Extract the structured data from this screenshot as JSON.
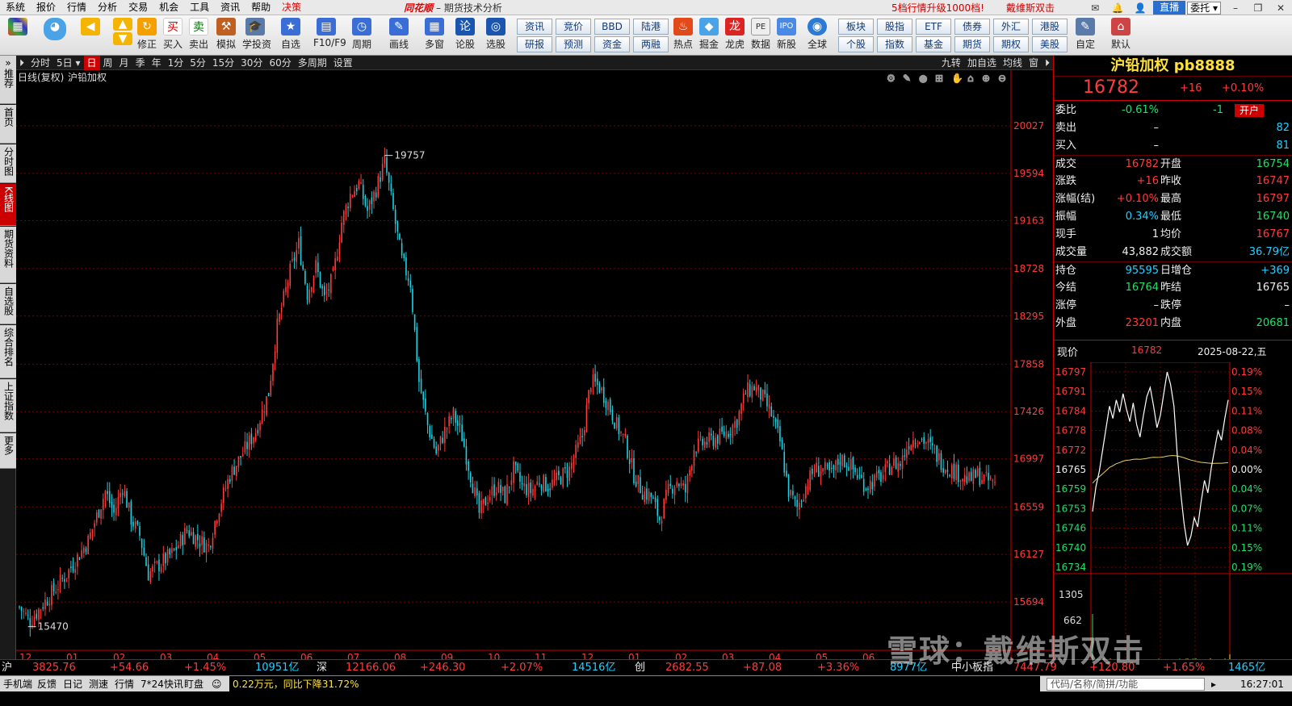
{
  "menubar": {
    "items": [
      "系统",
      "报价",
      "行情",
      "分析",
      "交易",
      "机会",
      "工具",
      "资讯",
      "帮助",
      "决策"
    ],
    "brand": "同花顺",
    "title": "期货技术分析",
    "promo": "5档行情升级1000档!",
    "promo2": "戴维斯双击",
    "live": "直播",
    "combo": "委托"
  },
  "toolbar": {
    "buttons": [
      "",
      "修正",
      "买入",
      "卖出",
      "模拟",
      "学投资",
      "自选",
      "F10/F9",
      "周期",
      "画线",
      "多窗",
      "论股",
      "选股",
      "",
      "热点",
      "掘金",
      "龙虎",
      "数据",
      "新股",
      "全球",
      "",
      "",
      "自定",
      "默认"
    ],
    "grid1": [
      "资讯",
      "竞价",
      "BBD",
      "陆港",
      "研报",
      "预测",
      "资金",
      "两融"
    ],
    "grid2": [
      "板块",
      "股指",
      "ETF",
      "债券",
      "外汇",
      "港股",
      "个股",
      "指数",
      "基金",
      "期货",
      "期权",
      "美股"
    ]
  },
  "vtabs": [
    "推荐",
    "首页",
    "分时图",
    "K线图",
    "期货资料",
    "自选股",
    "综合排名",
    "上证指数",
    "更多"
  ],
  "chart_toolbar": {
    "periods": [
      "分时",
      "5日",
      "日",
      "周",
      "月",
      "季",
      "年",
      "1分",
      "5分",
      "15分",
      "30分",
      "60分",
      "多周期",
      "设置"
    ],
    "active": "日",
    "right": [
      "九转",
      "加自选",
      "均线",
      "窗"
    ]
  },
  "chart_header": {
    "line": "日线(复权)",
    "name": "沪铅加权"
  },
  "chart_data": {
    "type": "candlestick",
    "ylim": [
      15262,
      20459
    ],
    "y_ticks": [
      20027,
      19594,
      19163,
      18728,
      18295,
      17858,
      17426,
      16997,
      16559,
      16127,
      15694
    ],
    "x_labels": [
      "12",
      "01",
      "02",
      "03",
      "04",
      "05",
      "06",
      "07",
      "08",
      "09",
      "10",
      "11",
      "12",
      "01",
      "02",
      "03",
      "04",
      "05",
      "06"
    ],
    "max_label": "19757",
    "min_label": "15470",
    "path_points": [
      [
        0,
        15650
      ],
      [
        5,
        15520
      ],
      [
        12,
        15700
      ],
      [
        22,
        15950
      ],
      [
        32,
        16250
      ],
      [
        40,
        16700
      ],
      [
        44,
        16500
      ],
      [
        48,
        16750
      ],
      [
        52,
        16450
      ],
      [
        56,
        16300
      ],
      [
        60,
        15950
      ],
      [
        66,
        16050
      ],
      [
        72,
        16150
      ],
      [
        78,
        16350
      ],
      [
        84,
        16250
      ],
      [
        88,
        16200
      ],
      [
        92,
        16500
      ],
      [
        98,
        16850
      ],
      [
        104,
        17050
      ],
      [
        110,
        17250
      ],
      [
        116,
        17600
      ],
      [
        120,
        18200
      ],
      [
        126,
        18700
      ],
      [
        130,
        18950
      ],
      [
        134,
        18500
      ],
      [
        138,
        18750
      ],
      [
        142,
        18450
      ],
      [
        146,
        18650
      ],
      [
        150,
        19150
      ],
      [
        154,
        19400
      ],
      [
        158,
        19500
      ],
      [
        162,
        19250
      ],
      [
        166,
        19450
      ],
      [
        170,
        19700
      ],
      [
        174,
        19250
      ],
      [
        178,
        18800
      ],
      [
        182,
        18600
      ],
      [
        186,
        17700
      ],
      [
        190,
        17300
      ],
      [
        194,
        17050
      ],
      [
        198,
        17250
      ],
      [
        202,
        17400
      ],
      [
        206,
        17200
      ],
      [
        210,
        16850
      ],
      [
        214,
        16500
      ],
      [
        218,
        16650
      ],
      [
        222,
        16750
      ],
      [
        226,
        16650
      ],
      [
        230,
        16900
      ],
      [
        234,
        16750
      ],
      [
        238,
        16700
      ],
      [
        242,
        16800
      ],
      [
        246,
        16750
      ],
      [
        250,
        16800
      ],
      [
        256,
        16900
      ],
      [
        262,
        17200
      ],
      [
        266,
        17700
      ],
      [
        270,
        17650
      ],
      [
        274,
        17500
      ],
      [
        278,
        17300
      ],
      [
        282,
        17150
      ],
      [
        286,
        16850
      ],
      [
        290,
        16700
      ],
      [
        294,
        16650
      ],
      [
        298,
        16450
      ],
      [
        302,
        16700
      ],
      [
        306,
        16800
      ],
      [
        310,
        16700
      ],
      [
        314,
        17100
      ],
      [
        320,
        17150
      ],
      [
        326,
        17200
      ],
      [
        330,
        17250
      ],
      [
        334,
        17350
      ],
      [
        338,
        17600
      ],
      [
        342,
        17650
      ],
      [
        346,
        17550
      ],
      [
        350,
        17400
      ],
      [
        354,
        17150
      ],
      [
        358,
        16700
      ],
      [
        362,
        16550
      ],
      [
        366,
        16750
      ],
      [
        370,
        16900
      ],
      [
        374,
        16900
      ],
      [
        378,
        16850
      ],
      [
        382,
        17000
      ],
      [
        386,
        16950
      ],
      [
        390,
        16850
      ],
      [
        394,
        16750
      ],
      [
        398,
        16800
      ],
      [
        402,
        16850
      ],
      [
        406,
        16950
      ],
      [
        410,
        16950
      ],
      [
        414,
        17150
      ],
      [
        418,
        17200
      ],
      [
        422,
        17150
      ],
      [
        426,
        17050
      ],
      [
        430,
        16950
      ],
      [
        434,
        16900
      ],
      [
        438,
        16850
      ],
      [
        442,
        16800
      ],
      [
        446,
        16850
      ],
      [
        450,
        16800
      ],
      [
        454,
        16780
      ]
    ]
  },
  "right_panel": {
    "name": "沪铅加权 pb8888",
    "price": "16782",
    "change": "+16",
    "change_pct": "+0.10%",
    "rows": [
      {
        "l1": "委比",
        "v1": "-0.61%",
        "c1": "grn",
        "v1b": "-1",
        "c1b": "grn",
        "tag": "开户"
      },
      {
        "l1": "卖出",
        "v1": "–",
        "c1": "wht",
        "v1b": "82",
        "c1b": "cyn"
      },
      {
        "l1": "买入",
        "v1": "–",
        "c1": "wht",
        "v1b": "81",
        "c1b": "cyn"
      },
      {
        "l1": "成交",
        "v1": "16782",
        "c1": "red",
        "l2": "开盘",
        "v2": "16754",
        "c2": "grn"
      },
      {
        "l1": "涨跌",
        "v1": "+16",
        "c1": "red",
        "l2": "昨收",
        "v2": "16747",
        "c2": "red"
      },
      {
        "l1": "涨幅(结)",
        "v1": "+0.10%",
        "c1": "red",
        "l2": "最高",
        "v2": "16797",
        "c2": "red"
      },
      {
        "l1": "振幅",
        "v1": "0.34%",
        "c1": "cyn",
        "l2": "最低",
        "v2": "16740",
        "c2": "grn"
      },
      {
        "l1": "现手",
        "v1": "1",
        "c1": "wht",
        "l2": "均价",
        "v2": "16767",
        "c2": "red"
      },
      {
        "l1": "成交量",
        "v1": "43,882",
        "c1": "wht",
        "l2": "成交额",
        "v2": "36.79亿",
        "c2": "cyn"
      },
      {
        "l1": "持仓",
        "v1": "95595",
        "c1": "cyn",
        "l2": "日增仓",
        "v2": "+369",
        "c2": "cyn"
      },
      {
        "l1": "今结",
        "v1": "16764",
        "c1": "grn",
        "l2": "昨结",
        "v2": "16765",
        "c2": "wht"
      },
      {
        "l1": "涨停",
        "v1": "–",
        "c1": "wht",
        "l2": "跌停",
        "v2": "–",
        "c2": "wht"
      },
      {
        "l1": "外盘",
        "v1": "23201",
        "c1": "red",
        "l2": "内盘",
        "v2": "20681",
        "c2": "grn"
      }
    ],
    "mini": {
      "label_now": "现价",
      "now_value": "16782",
      "date": "2025-08-22,五",
      "left_ticks": [
        "16797",
        "16791",
        "16784",
        "16778",
        "16772",
        "16765",
        "16759",
        "16753",
        "16746",
        "16740",
        "16734"
      ],
      "right_ticks": [
        "0.19%",
        "0.15%",
        "0.11%",
        "0.08%",
        "0.04%",
        "0.00%",
        "0.04%",
        "0.07%",
        "0.11%",
        "0.15%",
        "0.19%"
      ],
      "vol_ticks": [
        "1305",
        "662"
      ],
      "series": [
        16752,
        16760,
        16765,
        16772,
        16779,
        16786,
        16782,
        16788,
        16784,
        16790,
        16785,
        16781,
        16787,
        16780,
        16776,
        16783,
        16789,
        16792,
        16786,
        16779,
        16783,
        16790,
        16797,
        16793,
        16786,
        16770,
        16758,
        16748,
        16741,
        16744,
        16750,
        16747,
        16755,
        16762,
        16758,
        16766,
        16772,
        16778,
        16775,
        16782,
        16788
      ]
    }
  },
  "bottombar": {
    "items": [
      "沪",
      "3825.76",
      "+54.66",
      "+1.45%",
      "10951亿",
      "深",
      "12166.06",
      "+246.30",
      "+2.07%",
      "14516亿",
      "创",
      "2682.55",
      "+87.08",
      "+3.36%",
      "8977亿",
      "中小板指",
      "7447.79",
      "+120.80",
      "+1.65%",
      "1465亿"
    ]
  },
  "statusbar": {
    "items": [
      "手机端",
      "反馈",
      "日记",
      "测速",
      "行情",
      "7*24快讯",
      "盯盘"
    ],
    "news": "0.22万元，同比下降31.72%",
    "search": "代码/名称/简拼/功能",
    "time": "16:27:01"
  },
  "watermark": "雪球：戴维斯双击",
  "colors": {
    "up": "#ff3b3b",
    "down": "#1ed0e0",
    "grid": "#7a0000",
    "accent": "#cc0000"
  }
}
